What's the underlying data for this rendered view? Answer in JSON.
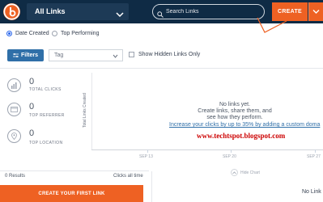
{
  "header": {
    "links_dropdown_label": "All Links",
    "search_placeholder": "Search Links",
    "create_label": "CREATE",
    "accent_color": "#ee6123",
    "bar_color": "#0f2b45"
  },
  "sort": {
    "date_created": "Date Created",
    "top_performing": "Top Performing",
    "selected": "date_created"
  },
  "filters": {
    "filters_label": "Filters",
    "tag_placeholder": "Tag",
    "hidden_links_label": "Show Hidden Links Only"
  },
  "stats": {
    "clicks_value": "0",
    "clicks_label": "TOTAL CLICKS",
    "referrer_value": "0",
    "referrer_label": "TOP REFERRER",
    "location_value": "0",
    "location_label": "TOP LOCATION"
  },
  "chart": {
    "y_label": "Total Links Created",
    "ticks": [
      "SEP 13",
      "SEP 20",
      "SEP 27"
    ],
    "empty_line1": "No links yet.",
    "empty_line2": "Create links, share them, and",
    "empty_line3": "see how they perform.",
    "custom_domain_link": "Increase your clicks by up to 35% by adding a custom doma",
    "hide_chart_label": "Hide Chart"
  },
  "watermark": "www.techtspot.blogspot.com",
  "list": {
    "results_label": "0 Results",
    "clicks_sort_label": "Clicks all time",
    "create_first_label": "CREATE YOUR FIRST LINK",
    "no_link_label": "No Link"
  }
}
